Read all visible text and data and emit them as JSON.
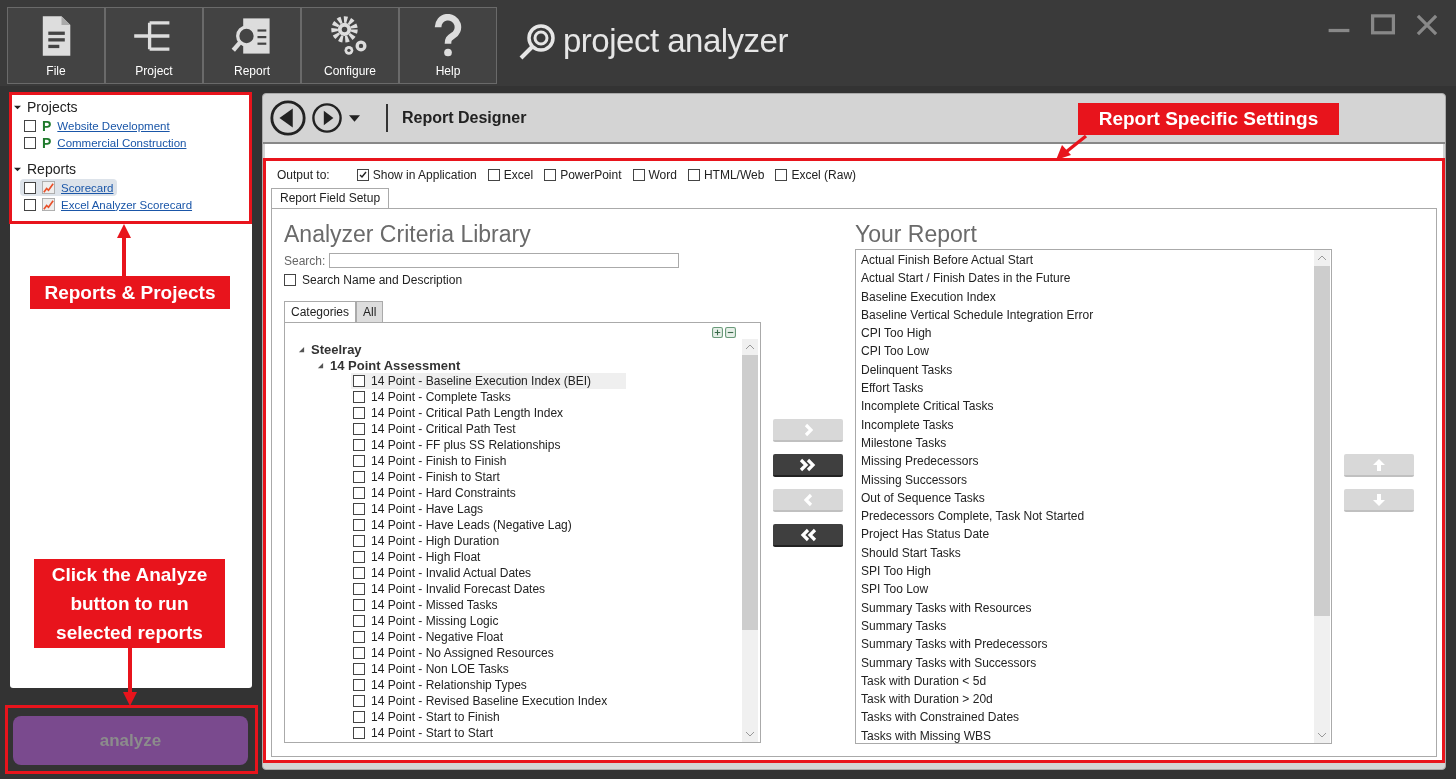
{
  "toolbar": [
    {
      "label": "File",
      "kind": "file"
    },
    {
      "label": "Project",
      "kind": "project"
    },
    {
      "label": "Report",
      "kind": "report"
    },
    {
      "label": "Configure",
      "kind": "configure"
    },
    {
      "label": "Help",
      "kind": "help"
    }
  ],
  "app_title": "project analyzer",
  "sidebar": {
    "groups": [
      {
        "label": "Projects",
        "expanded": true,
        "items": [
          {
            "label": "Website Development",
            "kind": "project",
            "icon_letter": "P",
            "checked": false,
            "selected": false
          },
          {
            "label": "Commercial Construction",
            "kind": "project",
            "icon_letter": "P",
            "checked": false,
            "selected": false
          }
        ]
      },
      {
        "label": "Reports",
        "expanded": true,
        "items": [
          {
            "label": "Scorecard",
            "kind": "report",
            "checked": false,
            "selected": true
          },
          {
            "label": "Excel Analyzer Scorecard",
            "kind": "report",
            "checked": false,
            "selected": false
          }
        ]
      }
    ]
  },
  "analyze_button": "analyze",
  "designer": {
    "title": "Report Designer",
    "output_label": "Output to:",
    "outputs": [
      {
        "label": "Show in Application",
        "checked": true
      },
      {
        "label": "Excel",
        "checked": false
      },
      {
        "label": "PowerPoint",
        "checked": false
      },
      {
        "label": "Word",
        "checked": false
      },
      {
        "label": "HTML/Web",
        "checked": false
      },
      {
        "label": "Excel (Raw)",
        "checked": false
      }
    ],
    "tabs": [
      {
        "label": "Report Field Setup",
        "selected": true
      }
    ],
    "library": {
      "title": "Analyzer Criteria Library",
      "search_label": "Search:",
      "search_option": {
        "label": "Search Name and Description",
        "checked": false
      },
      "tabs": [
        {
          "label": "Categories",
          "selected": true
        },
        {
          "label": "All",
          "selected": false
        }
      ],
      "tree": [
        {
          "label": "Steelray",
          "expanded": true,
          "children": [
            {
              "label": "14 Point Assessment",
              "expanded": true,
              "children": [
                {
                  "label": "14 Point - Baseline Execution Index (BEI)",
                  "checked": false,
                  "selected": true
                },
                {
                  "label": "14 Point - Complete Tasks",
                  "checked": false,
                  "selected": false
                },
                {
                  "label": "14 Point - Critical Path Length Index",
                  "checked": false,
                  "selected": false
                },
                {
                  "label": "14 Point - Critical Path Test",
                  "checked": false,
                  "selected": false
                },
                {
                  "label": "14 Point - FF plus SS Relationships",
                  "checked": false,
                  "selected": false
                },
                {
                  "label": "14 Point - Finish to Finish",
                  "checked": false,
                  "selected": false
                },
                {
                  "label": "14 Point - Finish to Start",
                  "checked": false,
                  "selected": false
                },
                {
                  "label": "14 Point - Hard Constraints",
                  "checked": false,
                  "selected": false
                },
                {
                  "label": "14 Point - Have Lags",
                  "checked": false,
                  "selected": false
                },
                {
                  "label": "14 Point - Have Leads (Negative Lag)",
                  "checked": false,
                  "selected": false
                },
                {
                  "label": "14 Point - High Duration",
                  "checked": false,
                  "selected": false
                },
                {
                  "label": "14 Point - High Float",
                  "checked": false,
                  "selected": false
                },
                {
                  "label": "14 Point - Invalid Actual Dates",
                  "checked": false,
                  "selected": false
                },
                {
                  "label": "14 Point - Invalid Forecast Dates",
                  "checked": false,
                  "selected": false
                },
                {
                  "label": "14 Point - Missed Tasks",
                  "checked": false,
                  "selected": false
                },
                {
                  "label": "14 Point - Missing Logic",
                  "checked": false,
                  "selected": false
                },
                {
                  "label": "14 Point - Negative Float",
                  "checked": false,
                  "selected": false
                },
                {
                  "label": "14 Point - No Assigned Resources",
                  "checked": false,
                  "selected": false
                },
                {
                  "label": "14 Point - Non LOE Tasks",
                  "checked": false,
                  "selected": false
                },
                {
                  "label": "14 Point - Relationship Types",
                  "checked": false,
                  "selected": false
                },
                {
                  "label": "14 Point - Revised Baseline Execution Index",
                  "checked": false,
                  "selected": false
                },
                {
                  "label": "14 Point - Start to Finish",
                  "checked": false,
                  "selected": false
                },
                {
                  "label": "14 Point - Start to Start",
                  "checked": false,
                  "selected": false
                }
              ]
            }
          ]
        }
      ]
    },
    "transfer_buttons": [
      {
        "kind": "add",
        "disabled": true
      },
      {
        "kind": "add_all",
        "disabled": false
      },
      {
        "kind": "remove",
        "disabled": true
      },
      {
        "kind": "remove_all",
        "disabled": false
      }
    ],
    "report": {
      "title": "Your Report",
      "items": [
        "Actual Finish Before Actual Start",
        "Actual Start / Finish Dates in the Future",
        "Baseline Execution Index",
        "Baseline Vertical Schedule Integration Error",
        "CPI Too High",
        "CPI Too Low",
        "Delinquent Tasks",
        "Effort Tasks",
        "Incomplete Critical Tasks",
        "Incomplete Tasks",
        "Milestone Tasks",
        "Missing Predecessors",
        "Missing Successors",
        "Out of Sequence Tasks",
        "Predecessors Complete, Task Not Started",
        "Project Has Status Date",
        "Should Start Tasks",
        "SPI Too High",
        "SPI Too Low",
        "Summary Tasks with Resources",
        "Summary Tasks",
        "Summary Tasks with Predecessors",
        "Summary Tasks with Successors",
        "Task with Duration < 5d",
        "Task with Duration > 20d",
        "Tasks with Constrained Dates",
        "Tasks with Missing WBS"
      ]
    },
    "move_buttons": [
      {
        "kind": "up",
        "disabled": true
      },
      {
        "kind": "down",
        "disabled": true
      }
    ]
  },
  "annotations": [
    {
      "kind": "projects",
      "text": "Reports & Projects"
    },
    {
      "kind": "settings",
      "text": "Report Specific Settings"
    },
    {
      "kind": "analyze",
      "text": "Click the Analyze button to run selected reports"
    }
  ]
}
